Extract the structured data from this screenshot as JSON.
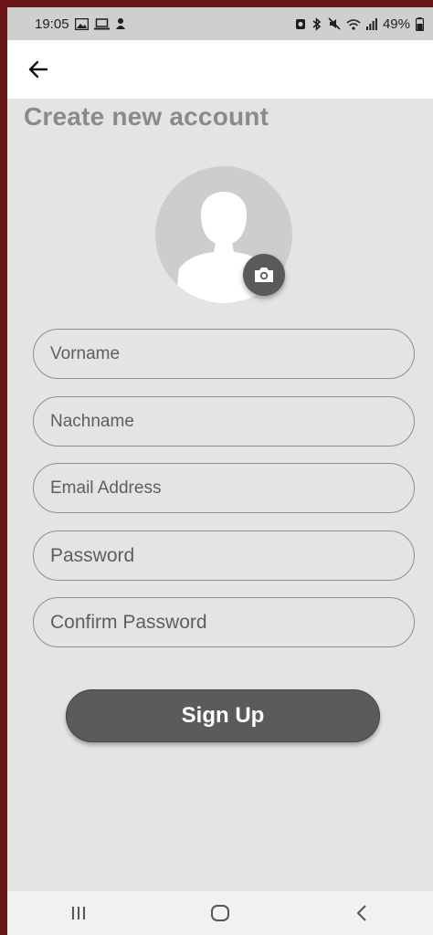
{
  "status_bar": {
    "time": "19:05",
    "battery": "49%",
    "icons_left": [
      "gallery-icon",
      "laptop-icon",
      "notification-icon"
    ],
    "icons_right": [
      "battery-saver-icon",
      "bluetooth-icon",
      "mute-icon",
      "wifi-icon",
      "signal-icon",
      "battery-icon"
    ]
  },
  "app_bar": {
    "back_icon": "arrow-left-icon"
  },
  "page": {
    "title": "Create new account"
  },
  "avatar": {
    "icon": "person-placeholder-icon",
    "camera_icon": "camera-icon"
  },
  "form": {
    "first_name_placeholder": "Vorname",
    "last_name_placeholder": "Nachname",
    "email_placeholder": "Email Address",
    "password_placeholder": "Password",
    "confirm_password_placeholder": "Confirm Password",
    "submit_label": "Sign Up"
  },
  "nav_bar": {
    "icons": [
      "recent-apps-icon",
      "home-icon",
      "back-icon"
    ]
  },
  "colors": {
    "frame": "#6b1616",
    "background": "#e4e4e4",
    "button": "#5b5b5b",
    "title": "#8a8a8a"
  }
}
